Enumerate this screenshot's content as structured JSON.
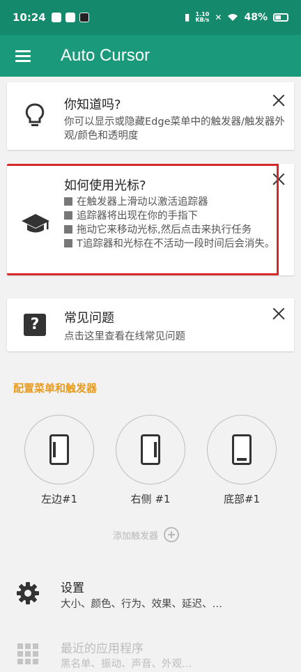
{
  "status_bar": {
    "time": "10:24",
    "speed_top": "1.10",
    "speed_bottom": "KB/s",
    "battery": "48%"
  },
  "app_bar": {
    "title": "Auto Cursor",
    "menu_icon": "hamburger-menu-icon"
  },
  "cards": {
    "did_you_know": {
      "icon": "lightbulb-icon",
      "title": "你知道吗?",
      "body": "你可以显示或隐藏Edge菜单中的触发器/触发器外观/颜色和透明度"
    },
    "how_to_use": {
      "icon": "graduation-cap-icon",
      "title": "如何使用光标?",
      "items": [
        "在触发器上滑动以激活追踪器",
        "追踪器将出现在你的手指下",
        "拖动它来移动光标,然后点击来执行任务",
        "T追踪器和光标在不活动一段时间后会消失。"
      ]
    },
    "faq": {
      "icon": "question-mark-icon",
      "title": "常见问题",
      "body": "点击这里查看在线常见问题"
    }
  },
  "section": {
    "title": "配置菜单和触发器"
  },
  "triggers": [
    {
      "label": "左边#1",
      "side": "left"
    },
    {
      "label": "右侧 #1",
      "side": "right"
    },
    {
      "label": "底部#1",
      "side": "bottom"
    }
  ],
  "add_trigger": {
    "label": "添加触发器"
  },
  "settings": {
    "title": "设置",
    "subtitle": "大小、颜色、行为、效果、延迟、…"
  },
  "recent_apps": {
    "title": "最近的应用程序",
    "subtitle": "黑名单、振动、声音、外观…"
  },
  "colors": {
    "status_bar": "#14896c",
    "app_bar": "#1a9a7a",
    "section_title": "#e69b1f",
    "highlight": "#d62828"
  }
}
